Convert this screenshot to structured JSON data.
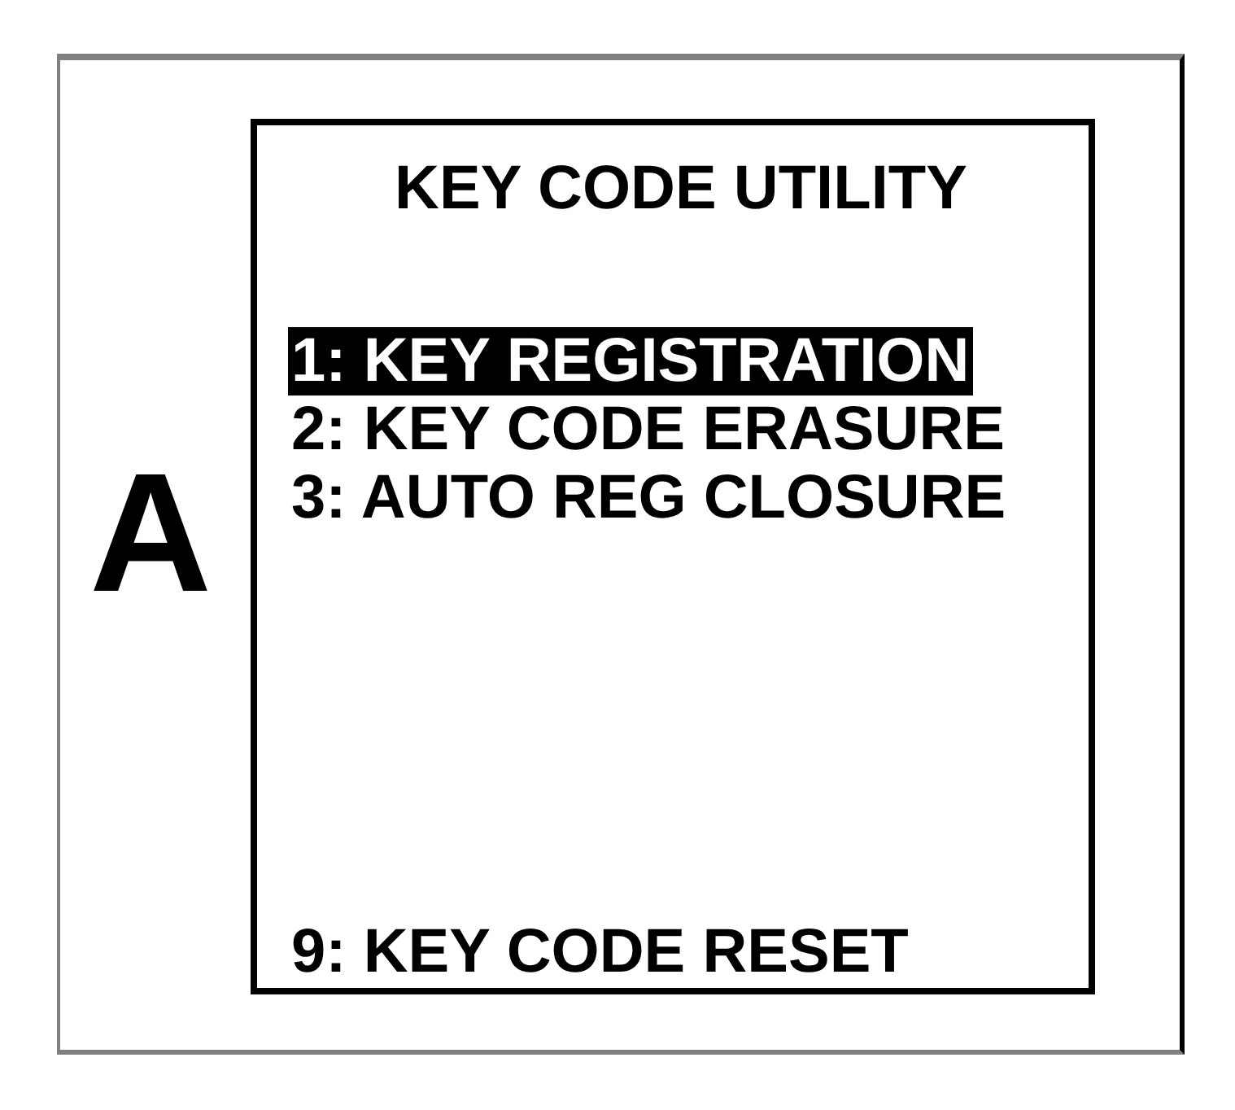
{
  "side_label": "A",
  "screen": {
    "title": "KEY CODE UTILITY",
    "menu_items": [
      {
        "label": "1: KEY REGISTRATION",
        "selected": true
      },
      {
        "label": "2: KEY CODE ERASURE",
        "selected": false
      },
      {
        "label": "3: AUTO REG CLOSURE",
        "selected": false
      }
    ],
    "bottom_item": {
      "label": "9: KEY CODE RESET",
      "selected": false
    }
  }
}
